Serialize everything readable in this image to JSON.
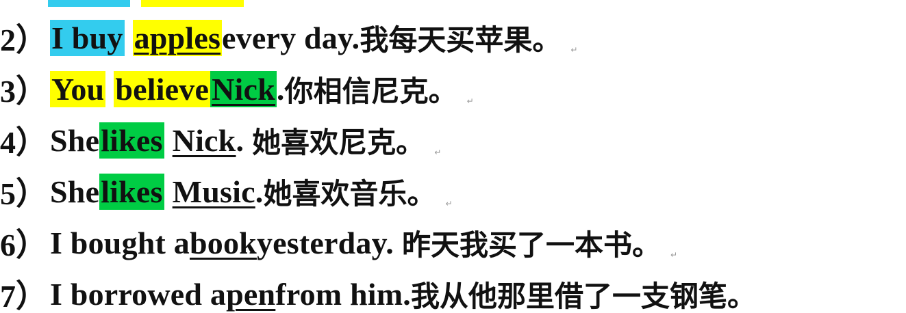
{
  "line1": {
    "num": "2）",
    "hl1": "I buy",
    "obj": "apples",
    "rest": " every day.",
    "zh": "我每天买苹果。"
  },
  "line2": {
    "num": "3）",
    "hl1": "You",
    "hl2": "believe",
    "obj": "Nick",
    "rest": ".",
    "zh": "你相信尼克。"
  },
  "line3": {
    "num": "4）",
    "pre": "She ",
    "verb": "likes",
    "obj": "Nick",
    "rest": ".",
    "zh": "她喜欢尼克。"
  },
  "line4": {
    "num": "5）",
    "pre": "She ",
    "verb": "likes",
    "obj": "Music",
    "rest": ".",
    "zh": "她喜欢音乐。"
  },
  "line5": {
    "num": "6）",
    "pre": "I bought a ",
    "obj": "book",
    "rest": " yesterday.",
    "zh": "昨天我买了一本书。"
  },
  "line6": {
    "num": "7）",
    "pre": "I borrowed a ",
    "obj": "pen",
    "rest": " from him.",
    "zh": "我从他那里借了一支钢笔。"
  },
  "paragraph_mark": "↵",
  "colors": {
    "cyan": "#33ccee",
    "yellow": "#ffff00",
    "green": "#00cc44"
  }
}
